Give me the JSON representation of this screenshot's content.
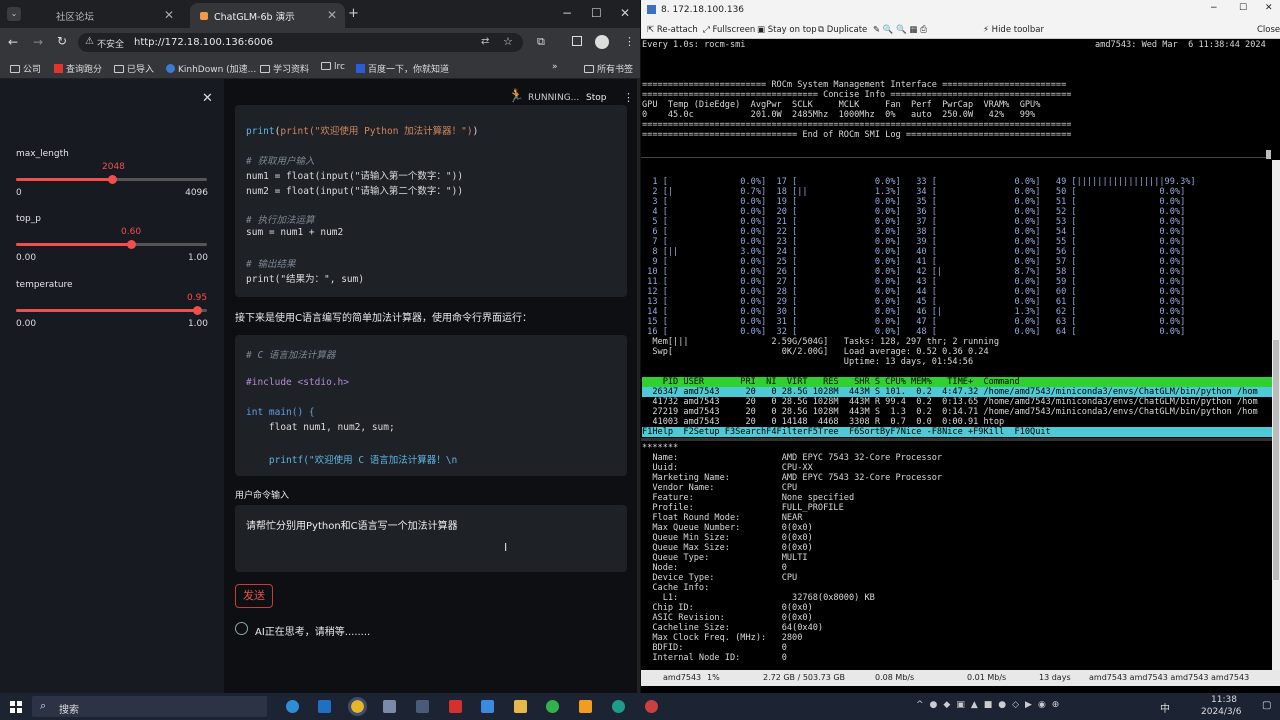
{
  "browser": {
    "tabs": [
      {
        "label": "社区论坛"
      },
      {
        "label": "ChatGLM-6b 演示"
      }
    ],
    "security_label": "不安全",
    "url": "http://172.18.100.136:6006",
    "bookmarks": [
      "公司",
      "查询跑分",
      "已导入",
      "KinhDown (加速...",
      "学习资料",
      "lrc",
      "百度一下，你就知道"
    ],
    "bookmarks_right": "所有书签"
  },
  "sidebar": {
    "params": [
      {
        "label": "max_length",
        "value": "2048",
        "min": "0",
        "max": "4096",
        "fraction": 0.5
      },
      {
        "label": "top_p",
        "value": "0.60",
        "min": "0.00",
        "max": "1.00",
        "fraction": 0.6
      },
      {
        "label": "temperature",
        "value": "0.95",
        "min": "0.00",
        "max": "1.00",
        "fraction": 0.95
      }
    ]
  },
  "main": {
    "status": "RUNNING...",
    "stop_label": "Stop",
    "py_code": [
      {
        "t": "print(\"欢迎使用 Python 加法计算器！\")"
      },
      {
        "t": "# 获取用户输入"
      },
      {
        "t": "num1 = float(input(\"请输入第一个数字：\"))"
      },
      {
        "t": "num2 = float(input(\"请输入第二个数字：\"))"
      },
      {
        "t": "# 执行加法运算"
      },
      {
        "t": "sum = num1 + num2"
      },
      {
        "t": "# 输出结果"
      },
      {
        "t": "print(\"结果为：\", sum)"
      }
    ],
    "c_intro": "接下来是使用C语言编写的简单加法计算器，使用命令行界面运行：",
    "c_code": [
      {
        "t": "# C 语言加法计算器"
      },
      {
        "t": "#include <stdio.h>"
      },
      {
        "t": "int main() {"
      },
      {
        "t": "    float num1, num2, sum;"
      },
      {
        "t": "    printf(\"欢迎使用 C 语言加法计算器！\\n"
      }
    ],
    "input_label": "用户命令输入",
    "input_value": "请帮忙分别用Python和C语言写一个加法计算器",
    "send_label": "发送",
    "thinking": "AI正在思考，请稍等........"
  },
  "terminal": {
    "title": "8. 172.18.100.136",
    "toolbar": [
      "Re-attach",
      "Fullscreen",
      "Stay on top",
      "Duplicate",
      "Hide toolbar",
      "Close"
    ],
    "smi_header": "Every 1.0s: rocm-smi",
    "smi_host": "amd7543: Wed Mar  6 11:38:44 2024",
    "smi_lines": [
      "======================== ROCm System Management Interface ========================",
      "================================== Concise Info ===================================",
      "GPU  Temp (DieEdge)  AvgPwr  SCLK     MCLK     Fan  Perf  PwrCap  VRAM%  GPU%",
      "0    45.0c           201.0W  2485Mhz  1000Mhz  0%   auto  250.0W   42%   99%",
      "===================================================================================",
      "============================== End of ROCm SMI Log ================================"
    ],
    "cpu_rows": [
      "  1 [              0.0%]  17 [               0.0%]   33 [               0.0%]   49 [|||||||||||||||||99.3%]",
      "  2 [|             0.7%]  18 [||             1.3%]   34 [               0.0%]   50 [                0.0%]",
      "  3 [              0.0%]  19 [               0.0%]   35 [               0.0%]   51 [                0.0%]",
      "  4 [              0.0%]  20 [               0.0%]   36 [               0.0%]   52 [                0.0%]",
      "  5 [              0.0%]  21 [               0.0%]   37 [               0.0%]   53 [                0.0%]",
      "  6 [              0.0%]  22 [               0.0%]   38 [               0.0%]   54 [                0.0%]",
      "  7 [              0.0%]  23 [               0.0%]   39 [               0.0%]   55 [                0.0%]",
      "  8 [||            3.0%]  24 [               0.0%]   40 [               0.0%]   56 [                0.0%]",
      "  9 [              0.0%]  25 [               0.0%]   41 [               0.0%]   57 [                0.0%]",
      " 10 [              0.0%]  26 [               0.0%]   42 [|              8.7%]   58 [                0.0%]",
      " 11 [              0.0%]  27 [               0.0%]   43 [               0.0%]   59 [                0.0%]",
      " 12 [              0.0%]  28 [               0.0%]   44 [               0.0%]   60 [                0.0%]",
      " 13 [              0.0%]  29 [               0.0%]   45 [               0.0%]   61 [                0.0%]",
      " 14 [              0.0%]  30 [               0.0%]   46 [|              1.3%]   62 [                0.0%]",
      " 15 [              0.0%]  31 [               0.0%]   47 [               0.0%]   63 [                0.0%]",
      " 16 [              0.0%]  32 [               0.0%]   48 [               0.0%]   64 [                0.0%]"
    ],
    "mem_line": "  Mem[|||                2.59G/504G]   Tasks: 128, 297 thr; 2 running",
    "swp_line": "  Swp[                     0K/2.00G]   Load average: 0.52 0.36 0.24",
    "uptime_line": "                                       Uptime: 13 days, 01:54:56",
    "proc_header": "    PID USER       PRI  NI  VIRT   RES   SHR S CPU% MEM%   TIME+  Command",
    "procs": [
      "  26347 amd7543     20   0 28.5G 1028M  443M S 101.  0.2  4:47.32 /home/amd7543/miniconda3/envs/ChatGLM/bin/python /hom",
      "  41732 amd7543     20   0 28.5G 1028M  443M R 99.4  0.2  0:13.65 /home/amd7543/miniconda3/envs/ChatGLM/bin/python /hom",
      "  27219 amd7543     20   0 28.5G 1028M  443M S  1.3  0.2  0:14.71 /home/amd7543/miniconda3/envs/ChatGLM/bin/python /hom",
      "  41003 amd7543     20   0 14148  4468  3308 R  0.7  0.0  0:00.91 htop"
    ],
    "fkeys": "F1Help  F2Setup F3SearchF4FilterF5Tree  F6SortByF7Nice -F8Nice +F9Kill  F10Quit",
    "agent_lines": [
      "*******",
      "  Name:                    AMD EPYC 7543 32-Core Processor",
      "  Uuid:                    CPU-XX",
      "  Marketing Name:          AMD EPYC 7543 32-Core Processor",
      "  Vendor Name:             CPU",
      "  Feature:                 None specified",
      "  Profile:                 FULL_PROFILE",
      "  Float Round Mode:        NEAR",
      "  Max Queue Number:        0(0x0)",
      "  Queue Min Size:          0(0x0)",
      "  Queue Max Size:          0(0x0)",
      "  Queue Type:              MULTI",
      "  Node:                    0",
      "  Device Type:             CPU",
      "  Cache Info:",
      "    L1:                      32768(0x8000) KB",
      "  Chip ID:                 0(0x0)",
      "  ASIC Revision:           0(0x0)",
      "  Cacheline Size:          64(0x40)",
      "  Max Clock Freq. (MHz):   2800",
      "  BDFID:                   0",
      "  Internal Node ID:        0"
    ],
    "status": [
      "amd7543",
      "1%",
      "2.72 GB / 503.73 GB",
      "0.08 Mb/s",
      "0.01 Mb/s",
      "13 days",
      "amd7543  amd7543  amd7543  amd7543"
    ]
  },
  "taskbar": {
    "search": "搜索",
    "ime": "中",
    "time": "11:38",
    "date": "2024/3/6"
  }
}
